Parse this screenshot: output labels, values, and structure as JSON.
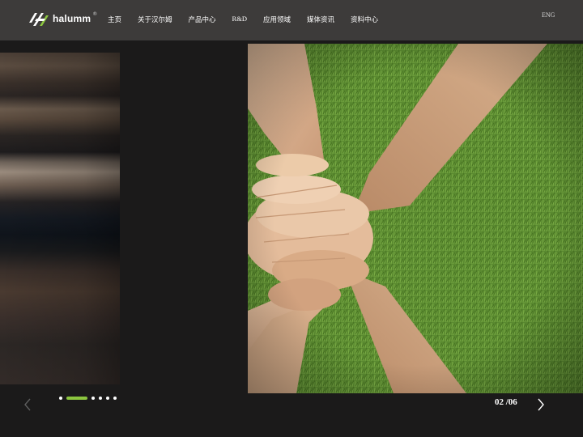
{
  "header": {
    "logo_text": "halumm",
    "logo_reg": "®",
    "nav": [
      {
        "label": "主页"
      },
      {
        "label": "关于汉尔姆"
      },
      {
        "label": "产品中心"
      },
      {
        "label": "R&D"
      },
      {
        "label": "应用领域"
      },
      {
        "label": "媒体资讯"
      },
      {
        "label": "资料中心"
      }
    ],
    "lang_label": "ENG"
  },
  "slider": {
    "current": "02",
    "total": "/06",
    "dot_count": 6,
    "active_dot": 1
  },
  "colors": {
    "header_bg": "#3d3b3a",
    "page_bg": "#1b1a1a",
    "accent": "#8cc63f"
  },
  "icons": {
    "logo": "halumm-logo-icon",
    "prev": "chevron-left-icon",
    "next": "chevron-right-icon"
  }
}
